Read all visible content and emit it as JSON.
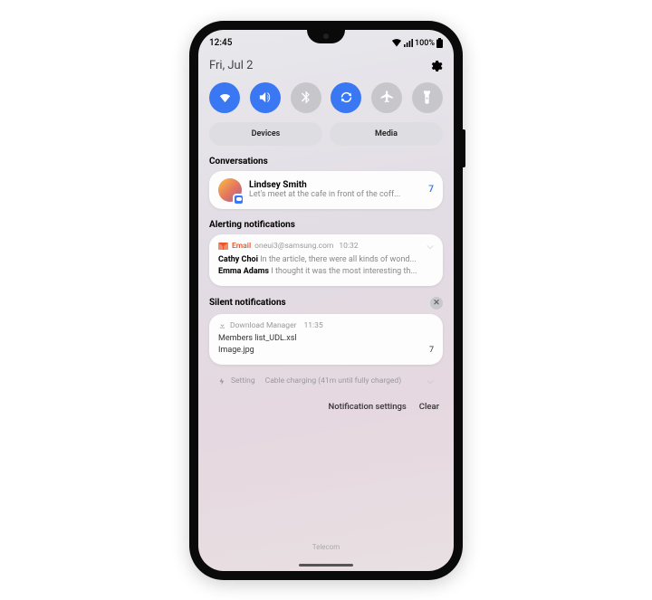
{
  "status": {
    "time": "12:45",
    "battery_pct": "100%"
  },
  "date": "Fri, Jul 2",
  "quick_settings": [
    {
      "name": "wifi-toggle",
      "on": true
    },
    {
      "name": "sound-toggle",
      "on": true
    },
    {
      "name": "bluetooth-toggle",
      "on": false
    },
    {
      "name": "rotate-toggle",
      "on": true
    },
    {
      "name": "airplane-toggle",
      "on": false
    },
    {
      "name": "flashlight-toggle",
      "on": false
    }
  ],
  "pills": {
    "devices": "Devices",
    "media": "Media"
  },
  "sections": {
    "conversations": "Conversations",
    "alerting": "Alerting notifications",
    "silent": "Silent notifications"
  },
  "conversation": {
    "name": "Lindsey Smith",
    "msg": "Let's meet at the cafe in front of the coff...",
    "count": "7"
  },
  "email": {
    "app": "Email",
    "account": "oneui3@samsung.com",
    "time": "10:32",
    "lines": [
      {
        "from": "Cathy Choi",
        "body": "In the article, there were all kinds of wond..."
      },
      {
        "from": "Emma Adams",
        "body": "I thought it was the most interesting th..."
      }
    ]
  },
  "download": {
    "app": "Download Manager",
    "time": "11:35",
    "files": [
      {
        "name": "Members list_UDL.xsl",
        "count": ""
      },
      {
        "name": "Image.jpg",
        "count": "7"
      }
    ]
  },
  "setting": {
    "app": "Setting",
    "text": "Cable charging (41m until fully charged)"
  },
  "footer": {
    "settings": "Notification settings",
    "clear": "Clear"
  },
  "carrier": "Telecom"
}
